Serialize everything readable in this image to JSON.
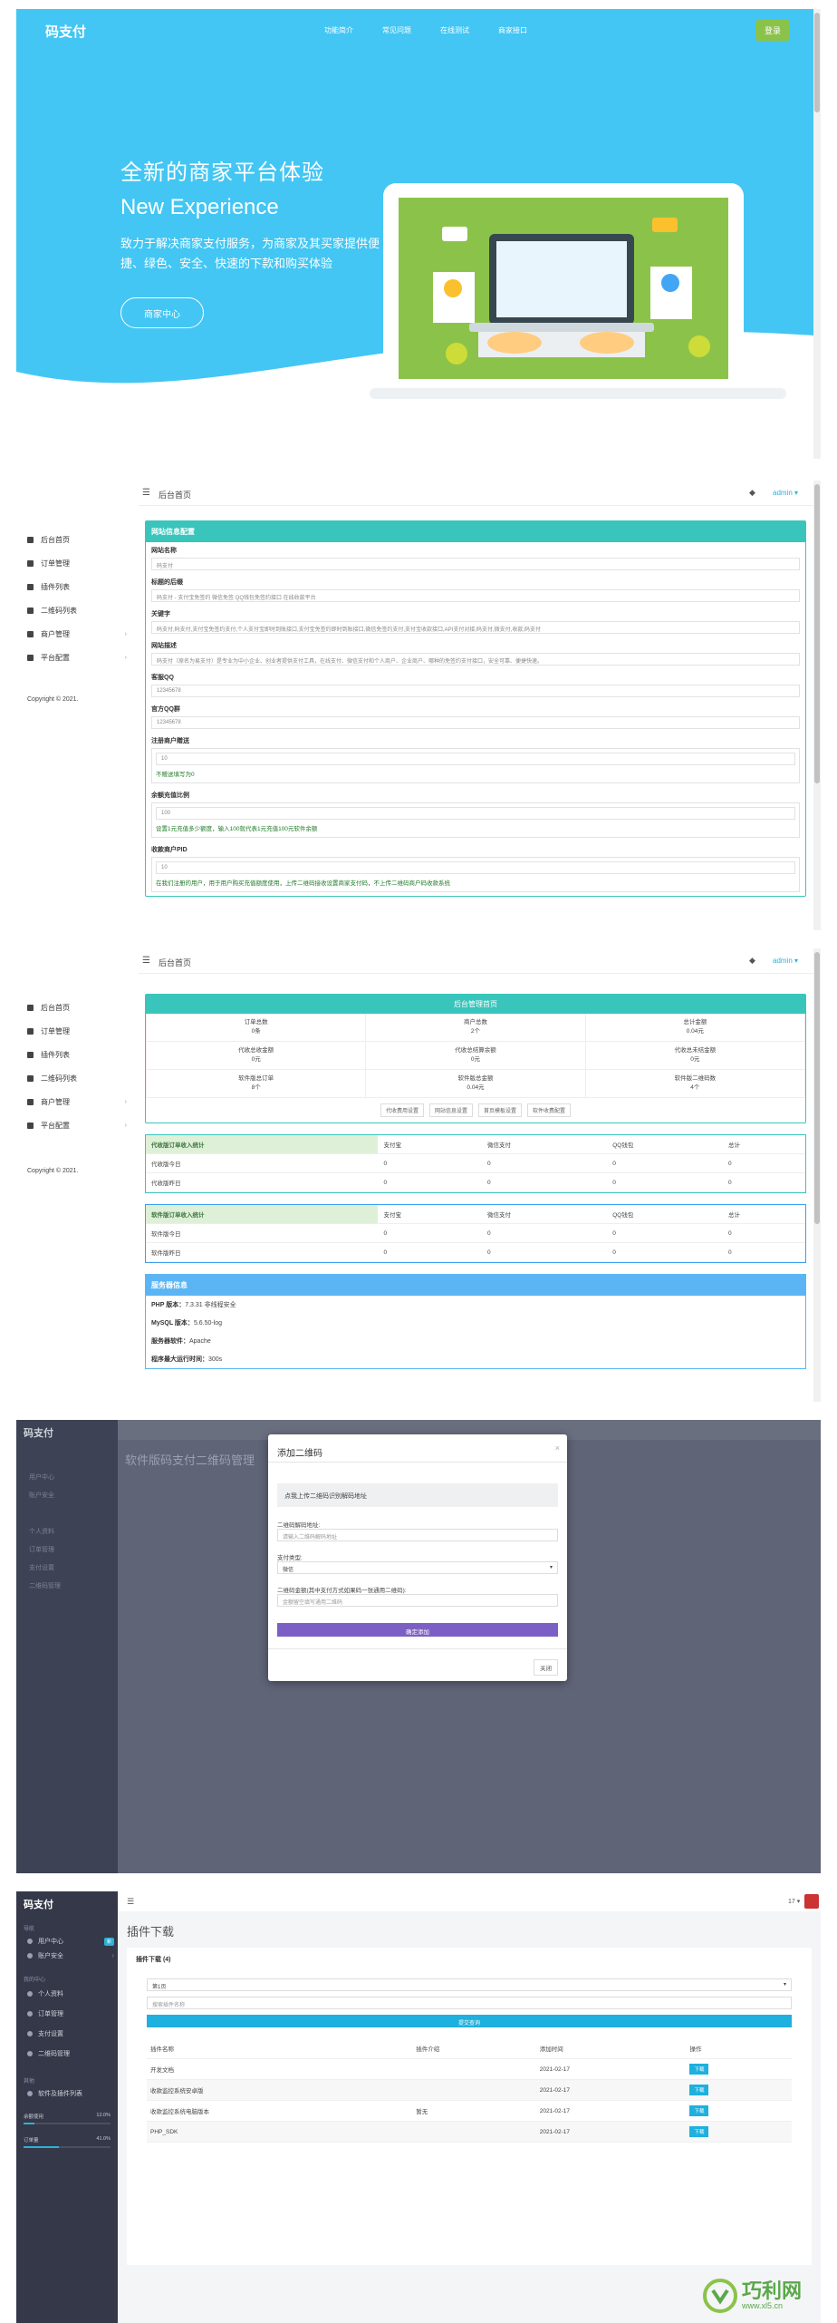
{
  "landing": {
    "logo": "码支付",
    "nav": [
      "功能简介",
      "常见问题",
      "在线测试",
      "商家接口"
    ],
    "login": "登录",
    "title": "全新的商家平台体验",
    "subtitle": "New Experience",
    "desc": "致力于解决商家支付服务，为商家及其买家提供便捷、绿色、安全、快速的下款和购买体验",
    "button": "商家中心"
  },
  "admin": {
    "sidebar": [
      "后台首页",
      "订单管理",
      "插件列表",
      "二维码列表",
      "商户管理",
      "平台配置"
    ],
    "copyright": "Copyright © 2021.",
    "breadcrumb": "后台首页",
    "user": "admin ▾"
  },
  "settings": {
    "header": "网站信息配置",
    "fields": [
      {
        "label": "网站名称",
        "value": "码支付"
      },
      {
        "label": "标题的后缀",
        "value": "码支付 - 支付宝免签约 微信免签 QQ钱包免签约接口 在线收款平台"
      },
      {
        "label": "关键字",
        "value": "码支付,码支付,支付宝免签约支付,个人支付宝即时到账接口,支付宝免签约即时到账接口,微信免签约支付,支付宝收款接口,API支付对接,码支付,微支付,收款,码支付"
      },
      {
        "label": "网站描述",
        "value": "码支付（原名为易支付）是专业为中小企业、创业者提供支付工具，在线支付、微信支付和个人商户、企业商户、哪种的免签约支付接口，安全可靠、便捷快速。"
      },
      {
        "label": "客服QQ",
        "value": "12345678"
      },
      {
        "label": "官方QQ群",
        "value": "12345678"
      }
    ],
    "groups": [
      {
        "label": "注册商户赠送",
        "value": "10",
        "hint": "不赠送填写为0"
      },
      {
        "label": "余额充值比例",
        "value": "100",
        "hint": "设置1元充值多少额度，输入100就代表1元充值100元软件余额"
      },
      {
        "label": "收款商户PID",
        "value": "10",
        "hint": "在我们注册的用户，用于用户购买充值额度使用，上传二维码接收设置商家支付码，不上传二维码商户码收款系统"
      }
    ]
  },
  "dashboard": {
    "title": "后台管理首页",
    "stats": [
      {
        "label": "订单总数",
        "value": "0条"
      },
      {
        "label": "商户总数",
        "value": "2个"
      },
      {
        "label": "总计金额",
        "value": "0.04元"
      },
      {
        "label": "代收总收金额",
        "value": "0元"
      },
      {
        "label": "代收总结算余额",
        "value": "0元"
      },
      {
        "label": "代收总未结金额",
        "value": "0元"
      },
      {
        "label": "软件版总订单",
        "value": "8个"
      },
      {
        "label": "软件版总金额",
        "value": "0.04元"
      },
      {
        "label": "软件版二维码数",
        "value": "4个"
      }
    ],
    "links": [
      "代收费用设置",
      "网站信息设置",
      "首页模板设置",
      "软件收费配置"
    ],
    "table_cols": [
      "支付宝",
      "微信支付",
      "QQ钱包",
      "总计"
    ],
    "table1": {
      "head": "代收版订单收入统计",
      "rows": [
        [
          "代收版今日",
          "0",
          "0",
          "0",
          "0"
        ],
        [
          "代收版昨日",
          "0",
          "0",
          "0",
          "0"
        ]
      ]
    },
    "table2": {
      "head": "软件版订单收入统计",
      "rows": [
        [
          "软件版今日",
          "0",
          "0",
          "0",
          "0"
        ],
        [
          "软件版昨日",
          "0",
          "0",
          "0",
          "0"
        ]
      ]
    },
    "server": {
      "head": "服务器信息",
      "rows": [
        {
          "k": "PHP 版本：",
          "v": "7.3.31 非线程安全"
        },
        {
          "k": "MySQL 版本：",
          "v": "5.6.50-log"
        },
        {
          "k": "服务器软件：",
          "v": "Apache"
        },
        {
          "k": "程序最大运行时间：",
          "v": "300s"
        }
      ]
    }
  },
  "modal": {
    "bg_logo": "码支付",
    "bg_title": "软件版码支付二维码管理",
    "title": "添加二维码",
    "close": "×",
    "upload": "点我上传二维码识别解码地址",
    "addr_label": "二维码解码地址:",
    "addr_placeholder": "请输入二维码解码地址",
    "type_label": "支付类型:",
    "type_value": "微信",
    "amount_label": "二维码金额(其中支付方式如果码一张通用二维码):",
    "amount_placeholder": "金额留空填写通用二维码",
    "submit": "确定添加",
    "close_btn": "关闭"
  },
  "plugins": {
    "logo": "码支付",
    "sec_nav": "导航",
    "nav": [
      {
        "label": "用户中心",
        "badge": "新"
      },
      {
        "label": "账户安全",
        "badge": ""
      }
    ],
    "sec_user": "我的中心",
    "user_items": [
      "个人资料",
      "订单管理",
      "支付设置",
      "二维码管理"
    ],
    "sec_other": "其他",
    "other_items": [
      "软件及插件列表"
    ],
    "bars": [
      {
        "label": "余额使用",
        "value": "12.0%",
        "pct": 12
      },
      {
        "label": "订单量",
        "value": "41.0%",
        "pct": 41
      }
    ],
    "count": "17 ▾",
    "page_title": "插件下载",
    "card_head": "插件下载 (4)",
    "select": "第1页",
    "search_placeholder": "搜索插件名称",
    "query": "提交查询",
    "cols": [
      "插件名称",
      "插件介绍",
      "添加时间",
      "操作"
    ],
    "rows": [
      {
        "name": "开发文档",
        "intro": "",
        "time": "2021-02-17",
        "op": "下载"
      },
      {
        "name": "收款监控系统安卓版",
        "intro": "",
        "time": "2021-02-17",
        "op": "下载"
      },
      {
        "name": "收款监控系统电脑版本",
        "intro": "暂无",
        "time": "2021-02-17",
        "op": "下载"
      },
      {
        "name": "PHP_SDK",
        "intro": "",
        "time": "2021-02-17",
        "op": "下载"
      }
    ],
    "watermark": "巧利网",
    "watermark_url": "www.xl5.cn"
  }
}
